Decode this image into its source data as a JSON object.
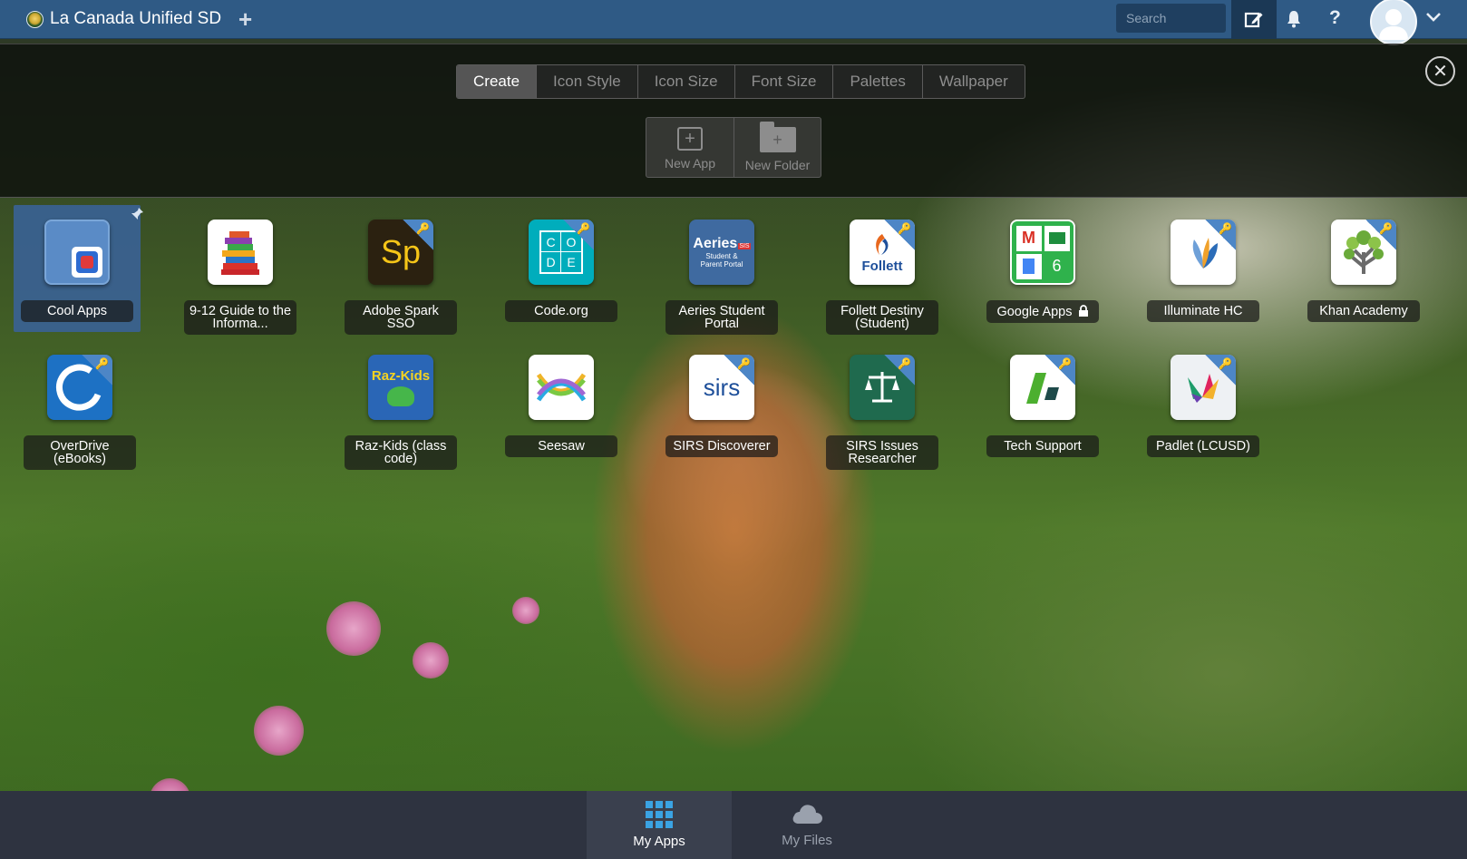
{
  "topbar": {
    "district_name": "La Canada Unified SD",
    "add_tab_label": "+",
    "search_placeholder": "Search",
    "help_label": "?"
  },
  "customize_panel": {
    "tabs": [
      {
        "label": "Create",
        "active": true
      },
      {
        "label": "Icon Style",
        "active": false
      },
      {
        "label": "Icon Size",
        "active": false
      },
      {
        "label": "Font Size",
        "active": false
      },
      {
        "label": "Palettes",
        "active": false
      },
      {
        "label": "Wallpaper",
        "active": false
      }
    ],
    "new_app_label": "New App",
    "new_folder_label": "New Folder",
    "close_label": "✕"
  },
  "apps": [
    {
      "label": "Cool Apps",
      "icon": "folder-icon",
      "selected": true
    },
    {
      "label": "9-12 Guide to the Informa...",
      "icon": "books-icon"
    },
    {
      "label": "Adobe Spark SSO",
      "icon": "adobe-spark-icon",
      "icon_text": "Sp"
    },
    {
      "label": "Code.org",
      "icon": "code-org-icon",
      "icon_text": [
        "C",
        "O",
        "D",
        "E"
      ]
    },
    {
      "label": "Aeries Student Portal",
      "icon": "aeries-icon",
      "icon_text": [
        "Aeries",
        "SIS",
        "Student &",
        "Parent Portal"
      ]
    },
    {
      "label": "Follett Destiny (Student)",
      "icon": "follett-icon",
      "icon_text": "Follett"
    },
    {
      "label": "Google Apps",
      "icon": "google-apps-icon",
      "icon_text": "6",
      "locked": true
    },
    {
      "label": "Illuminate HC",
      "icon": "illuminate-icon"
    },
    {
      "label": "Khan Academy",
      "icon": "khan-academy-icon"
    },
    {
      "label": "OverDrive (eBooks)",
      "icon": "overdrive-icon"
    },
    {
      "label": "Raz-Kids (class code)",
      "icon": "raz-kids-icon",
      "icon_text": "Raz-Kids"
    },
    {
      "label": "Seesaw",
      "icon": "seesaw-icon"
    },
    {
      "label": "SIRS Discoverer",
      "icon": "sirs-icon",
      "icon_text": "sirs"
    },
    {
      "label": "SIRS Issues Researcher",
      "icon": "sirs-issues-icon"
    },
    {
      "label": "Tech Support",
      "icon": "tech-support-icon"
    },
    {
      "label": "Padlet (LCUSD)",
      "icon": "padlet-icon"
    }
  ],
  "bottombar": {
    "tabs": [
      {
        "label": "My Apps",
        "active": true
      },
      {
        "label": "My Files",
        "active": false
      }
    ]
  },
  "colors": {
    "topbar": "#2f5a85",
    "selected_folder": "#3a6296",
    "sso_badge": "#4d86c6",
    "bottombar": "#2e3340"
  }
}
